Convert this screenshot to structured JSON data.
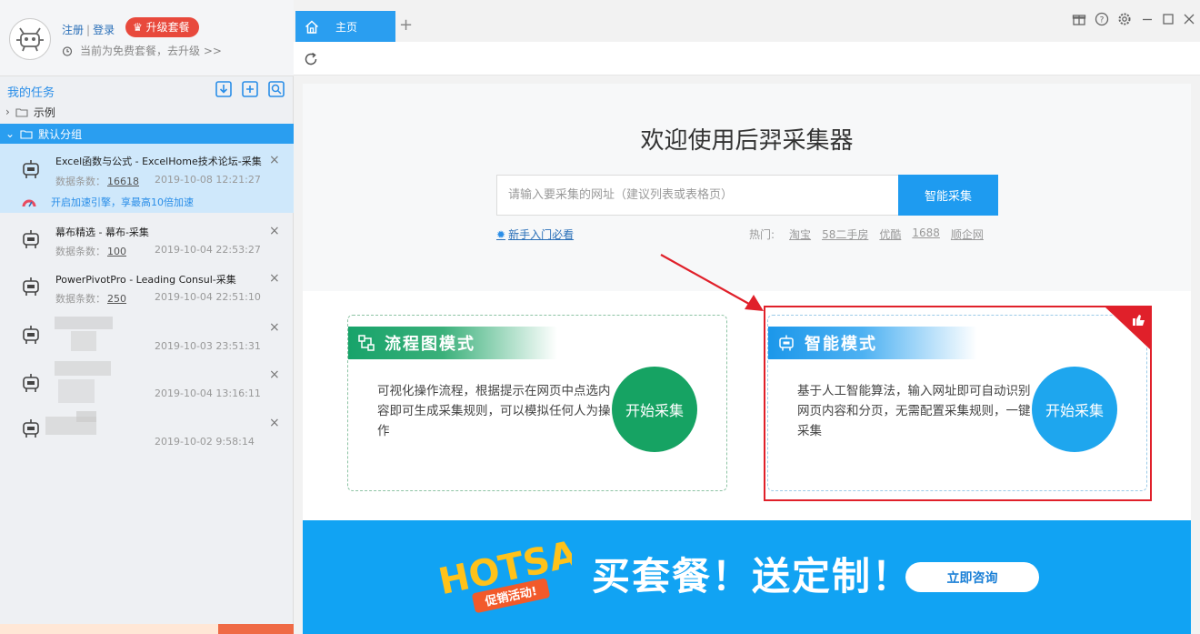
{
  "user": {
    "register_label": "注册",
    "login_label": "登录",
    "upgrade_label": "升级套餐",
    "plan_status": "当前为免费套餐，去升级 >>"
  },
  "tasks": {
    "title": "我的任务",
    "groups": [
      {
        "label": "示例"
      },
      {
        "label": "默认分组"
      }
    ],
    "items": [
      {
        "title": "Excel函数与公式 - ExcelHome技术论坛-采集",
        "meta_label": "数据条数：",
        "count": "16618",
        "date": "2019-10-08 12:21:27",
        "accel": "开启加速引擎，享最高10倍加速"
      },
      {
        "title": "幕布精选 - 幕布-采集",
        "meta_label": "数据条数：",
        "count": "100",
        "date": "2019-10-04 22:53:27"
      },
      {
        "title": "PowerPivotPro - Leading Consul-采集",
        "meta_label": "数据条数：",
        "count": "250",
        "date": "2019-10-04 22:51:10"
      },
      {
        "date": "2019-10-03 23:51:31"
      },
      {
        "date": "2019-10-04 13:16:11"
      },
      {
        "date": "2019-10-02 9:58:14"
      }
    ],
    "close_glyph": "×"
  },
  "tabs": [
    {
      "label": "主页"
    }
  ],
  "tab_add_glyph": "+",
  "home": {
    "welcome_title": "欢迎使用后羿采集器",
    "search_placeholder": "请输入要采集的网址（建议列表或表格页）",
    "search_button": "智能采集",
    "beginner_link": "新手入门必看",
    "hot_label": "热门:",
    "hot_links": [
      "淘宝",
      "58二手房",
      "优酷",
      "1688",
      "顺企网"
    ]
  },
  "modes": {
    "flow": {
      "title": "流程图模式",
      "description": "可视化操作流程，根据提示在网页中点选内容即可生成采集规则，可以模拟任何人为操作",
      "button": "开始采集"
    },
    "smart": {
      "title": "智能模式",
      "description": "基于人工智能算法，输入网址即可自动识别网页内容和分页，无需配置采集规则，一键采集",
      "button": "开始采集"
    }
  },
  "promo": {
    "hot_text": "HOTSALE",
    "badge_text": "促销活动!",
    "slogan": "买套餐！送定制！",
    "button": "立即咨询"
  },
  "colors": {
    "accent_blue": "#1e9bf0",
    "flow_green": "#16a363",
    "highlight_red": "#e0202a",
    "upgrade_red": "#e8493c"
  },
  "icons": [
    "robot-icon",
    "alarm-icon",
    "crown-icon",
    "import-icon",
    "add-task-icon",
    "search-task-icon",
    "folder-icon",
    "home-icon",
    "refresh-icon",
    "gift-icon",
    "help-icon",
    "settings-icon",
    "minimize-icon",
    "maximize-icon",
    "close-icon",
    "bulb-icon",
    "flowchart-icon",
    "thumbs-up-icon"
  ]
}
